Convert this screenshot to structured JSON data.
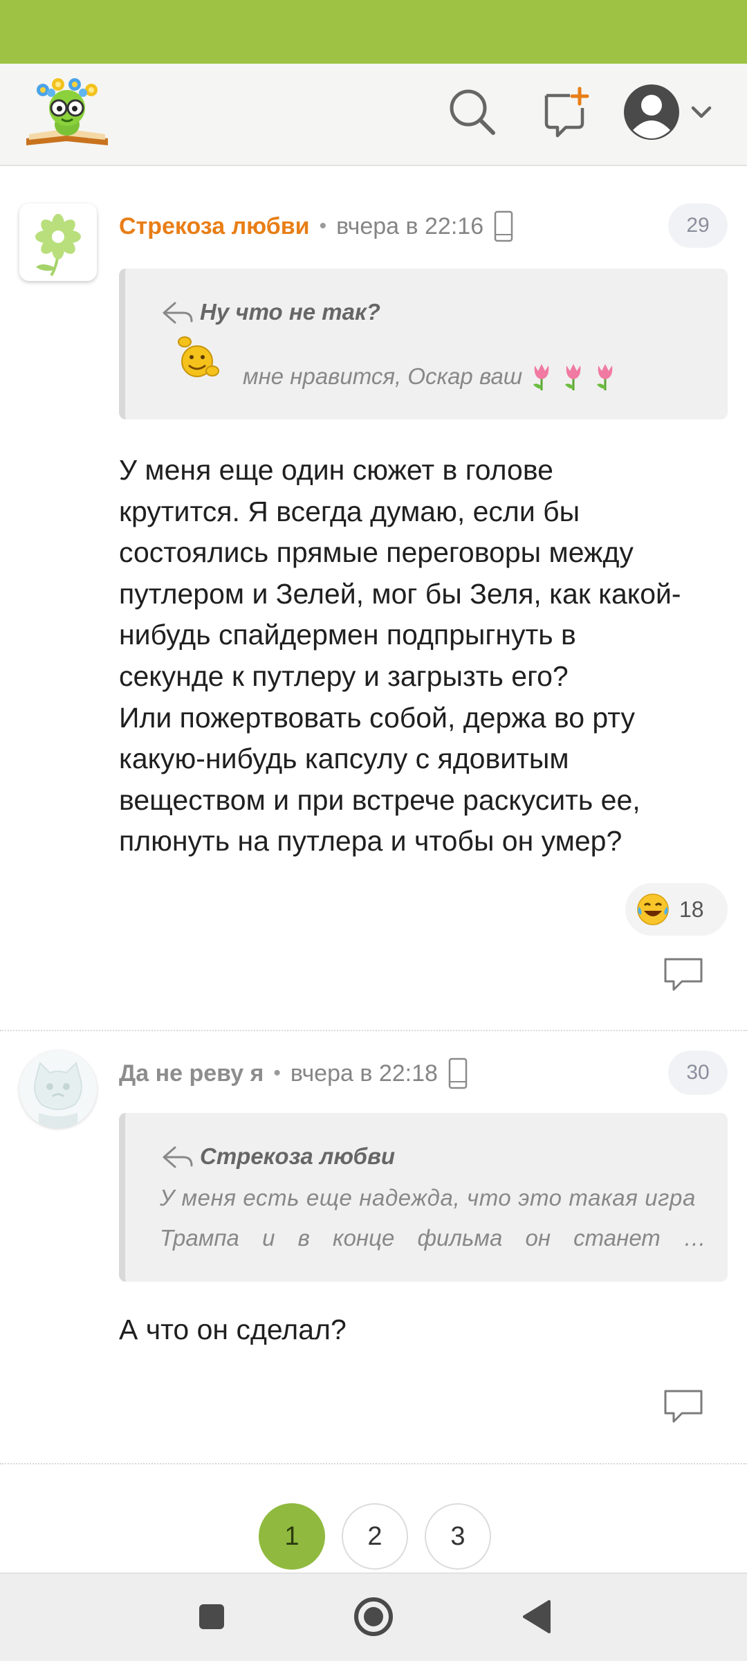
{
  "app": {
    "brand": "#9dc244",
    "accent": "#e87e16"
  },
  "header": {
    "logo": "bookworm-logo",
    "icons": [
      "search-icon",
      "new-topic-icon",
      "user-avatar-icon",
      "chevron-down-icon"
    ]
  },
  "comments": [
    {
      "author": "Стрекоза любви",
      "separator": "•",
      "time": "вчера в 22:16",
      "device": "phone-icon",
      "number": "29",
      "quote": {
        "title": "Ну что не так?",
        "text": "мне нравится, Оскар ваш",
        "emoji": "waving-smiley",
        "tail_icons": [
          "tulip-icon",
          "tulip-icon",
          "tulip-icon"
        ]
      },
      "body_lines": [
        "У меня еще один сюжет в голове",
        "крутится. Я всегда думаю, если бы",
        "состоялись прямые переговоры между",
        "путлером и Зелей, мог бы Зеля, как какой-",
        "нибудь спайдермен подпрыгнуть в",
        "секунде к путлеру и загрызть его?",
        "Или пожертвовать собой, держа во рту",
        "какую-нибудь капсулу с ядовитым",
        "веществом и при встрече раскусить ее,",
        "плюнуть на путлера и чтобы он умер?"
      ],
      "reaction": {
        "emoji": "laughing-tears",
        "count": "18"
      }
    },
    {
      "author": "Да не реву я",
      "separator": "•",
      "time": "вчера в 22:18",
      "device": "phone-icon",
      "number": "30",
      "quote": {
        "title": "Стрекоза любви",
        "lines": [
          "У меня есть еще надежда, что это такая игра",
          "Трампа и в конце фильма он станет …"
        ]
      },
      "body_lines": [
        "А что он сделал?"
      ]
    }
  ],
  "pagination": {
    "pages": [
      "1",
      "2",
      "3"
    ],
    "current": "1"
  },
  "navbar": {
    "icons": [
      "recents-icon",
      "home-icon",
      "back-icon"
    ]
  }
}
